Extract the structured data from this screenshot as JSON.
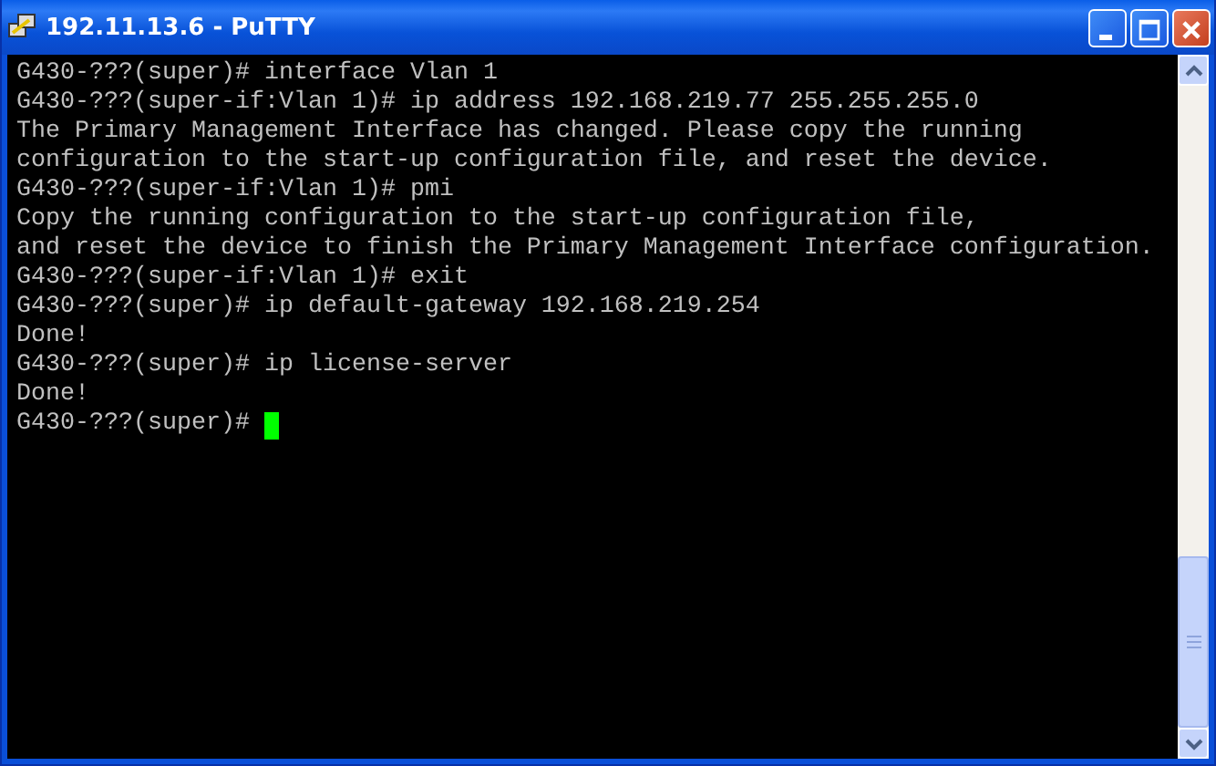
{
  "window": {
    "title": "192.11.13.6 - PuTTY"
  },
  "terminal": {
    "lines": [
      "G430-???(super)# interface Vlan 1",
      "G430-???(super-if:Vlan 1)# ip address 192.168.219.77 255.255.255.0",
      "The Primary Management Interface has changed. Please copy the running",
      "configuration to the start-up configuration file, and reset the device.",
      "G430-???(super-if:Vlan 1)# pmi",
      "Copy the running configuration to the start-up configuration file,",
      "and reset the device to finish the Primary Management Interface configuration.",
      "G430-???(super-if:Vlan 1)# exit",
      "G430-???(super)# ip default-gateway 192.168.219.254",
      "Done!",
      "G430-???(super)# ip license-server",
      "Done!"
    ],
    "prompt": "G430-???(super)#"
  }
}
